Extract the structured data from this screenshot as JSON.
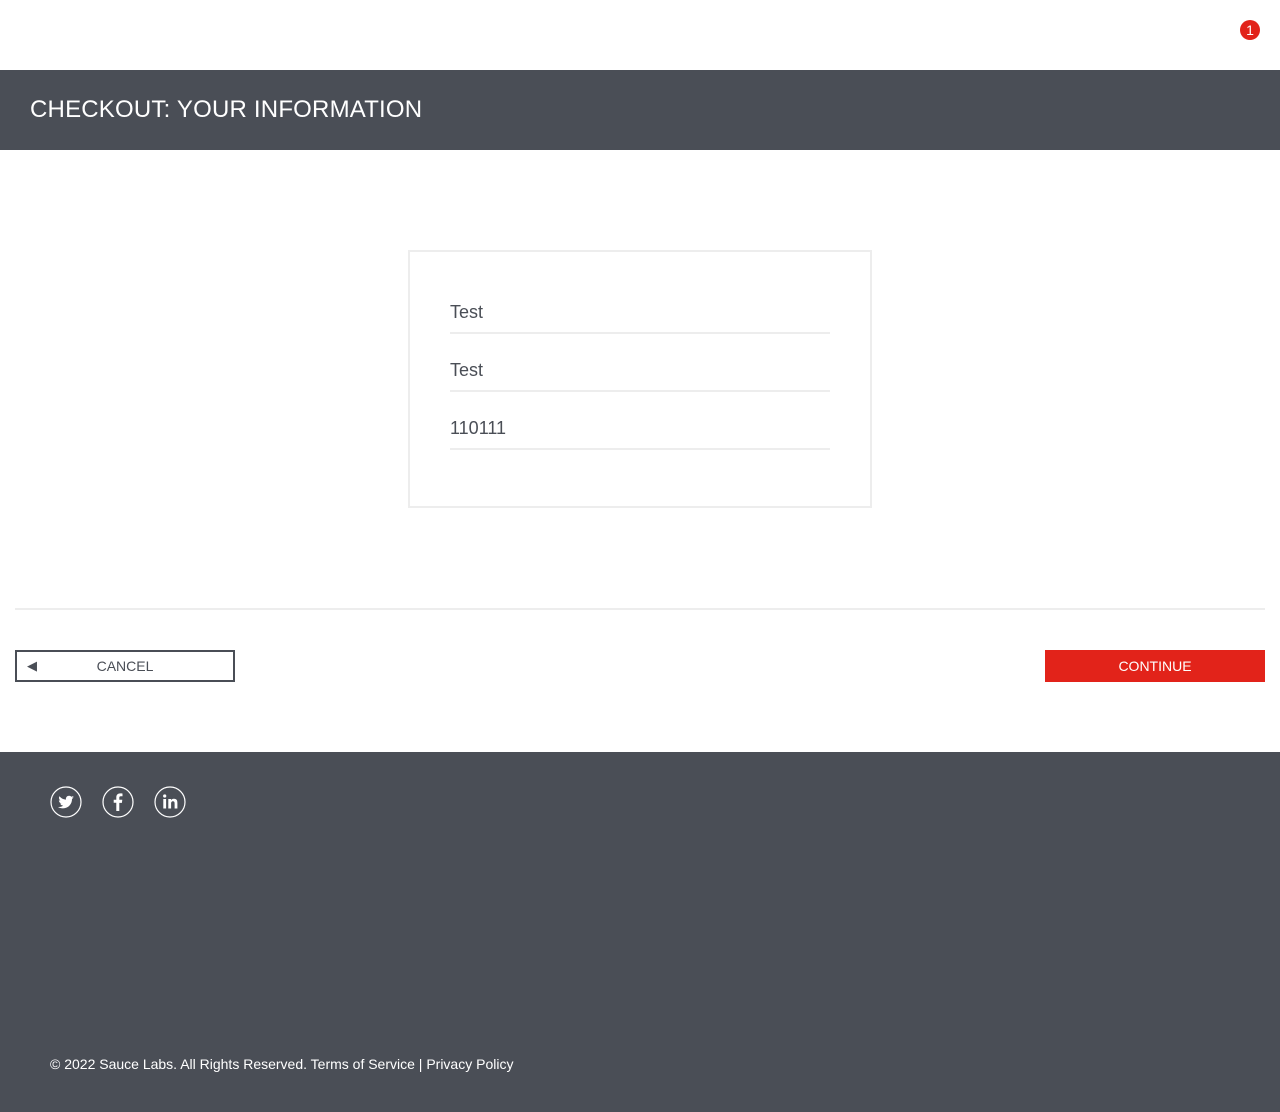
{
  "top_bar": {
    "cart_count": "1",
    "cart_badge_color": "#e2231a"
  },
  "header": {
    "title": "CHECKOUT: YOUR INFORMATION",
    "background_color": "#4a4e56"
  },
  "form": {
    "first_name_value": "Test",
    "last_name_value": "Test",
    "postal_code_value": "110111"
  },
  "actions": {
    "cancel_arrow": "◀",
    "cancel_label": "CANCEL",
    "continue_label": "CONTINUE",
    "accent_color": "#e2231a"
  },
  "footer": {
    "social_icons": [
      "twitter-icon",
      "facebook-icon",
      "linkedin-icon"
    ],
    "copyright": "© 2022 Sauce Labs. All Rights Reserved. Terms of Service | Privacy Policy"
  }
}
